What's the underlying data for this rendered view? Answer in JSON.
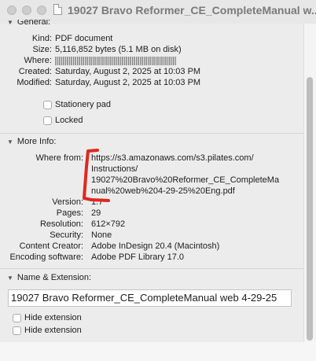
{
  "window": {
    "title": "19027 Bravo Reformer_CE_CompleteManual w..."
  },
  "general": {
    "header": "General:",
    "kind_label": "Kind:",
    "kind_value": "PDF document",
    "size_label": "Size:",
    "size_value": "5,116,852 bytes (5.1 MB on disk)",
    "where_label": "Where:",
    "created_label": "Created:",
    "created_value": "Saturday, August 2, 2025 at 10:03 PM",
    "modified_label": "Modified:",
    "modified_value": "Saturday, August 2, 2025 at 10:03 PM",
    "stationery_label": "Stationery pad",
    "locked_label": "Locked"
  },
  "more_info": {
    "header": "More Info:",
    "where_from_label": "Where from:",
    "where_from_lines": [
      "https://s3.amazonaws.com/s3.pilates.com/",
      "Instructions/",
      "19027%20Bravo%20Reformer_CE_CompleteMa",
      "nual%20web%204-29-25%20Eng.pdf"
    ],
    "version_label": "Version:",
    "version_value": "1.7",
    "pages_label": "Pages:",
    "pages_value": "29",
    "resolution_label": "Resolution:",
    "resolution_value": "612×792",
    "security_label": "Security:",
    "security_value": "None",
    "content_creator_label": "Content Creator:",
    "content_creator_value": "Adobe InDesign 20.4 (Macintosh)",
    "encoding_label": "Encoding software:",
    "encoding_value": "Adobe PDF Library 17.0"
  },
  "name_extension": {
    "header": "Name & Extension:",
    "filename": "19027 Bravo Reformer_CE_CompleteManual web 4-29-25",
    "hide_extension_label": "Hide extension",
    "hide_extension_label_2": "Hide extension"
  },
  "colors": {
    "annotation_red": "#e0281f"
  }
}
